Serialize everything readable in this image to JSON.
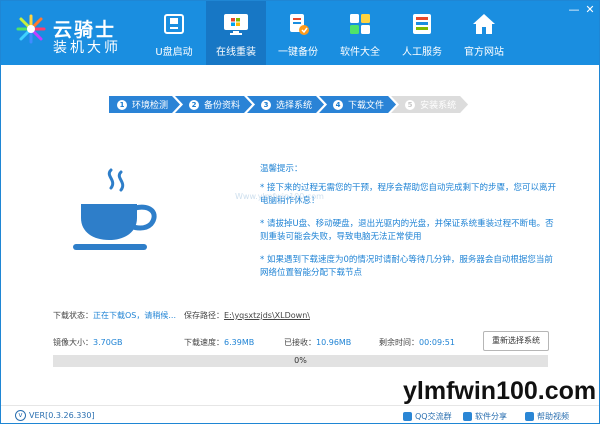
{
  "header": {
    "brand_line1": "云骑士",
    "brand_line2": "装机大师",
    "nav": [
      {
        "label": "U盘启动",
        "icon": "usb-drive-icon"
      },
      {
        "label": "在线重装",
        "icon": "windows-monitor-icon",
        "active": true
      },
      {
        "label": "一键备份",
        "icon": "backup-icon"
      },
      {
        "label": "软件大全",
        "icon": "app-grid-icon"
      },
      {
        "label": "人工服务",
        "icon": "customer-service-icon"
      },
      {
        "label": "官方网站",
        "icon": "home-icon"
      }
    ],
    "window_controls": {
      "minimize": "—",
      "close": "✕"
    }
  },
  "steps": [
    {
      "num": "1",
      "label": "环境检测",
      "state": "done"
    },
    {
      "num": "2",
      "label": "备份资料",
      "state": "done"
    },
    {
      "num": "3",
      "label": "选择系统",
      "state": "done"
    },
    {
      "num": "4",
      "label": "下载文件",
      "state": "done"
    },
    {
      "num": "5",
      "label": "安装系统",
      "state": "todo"
    }
  ],
  "tips": {
    "title": "温馨提示：",
    "items": [
      "* 接下来的过程无需您的干预，程序会帮助您自动完成剩下的步骤，您可以离开电脑稍作休息！",
      "* 请拔掉U盘、移动硬盘，退出光驱内的光盘，并保证系统重装过程不断电。否则重装可能会失败，导致电脑无法正常使用",
      "* 如果遇到下载速度为0的情况时请耐心等待几分钟，服务器会自动根据您当前网络位置智能分配下载节点"
    ],
    "watermark": "Www.ylmfwin100.com"
  },
  "download": {
    "status_label": "下载状态：",
    "status_value": "正在下载OS，请稍候...",
    "save_path_label": "保存路径：",
    "save_path_value": "E:\\yqsxtzjds\\XLDown\\",
    "image_size_label": "镜像大小：",
    "image_size_value": "3.70GB",
    "speed_label": "下载速度：",
    "speed_value": "6.39MB",
    "downloaded_label": "已接收：",
    "downloaded_value": "10.96MB",
    "remaining_label": "剩余时间：",
    "remaining_value": "00:09:51",
    "reselect_label": "重新选择系统",
    "progress_percent": 0,
    "progress_text": "0%"
  },
  "footer": {
    "version": "VER[0.3.26.330]",
    "links": [
      {
        "label": "QQ交流群",
        "icon": "qq-icon"
      },
      {
        "label": "软件分享",
        "icon": "share-icon"
      },
      {
        "label": "帮助视频",
        "icon": "help-video-icon"
      }
    ],
    "brand_watermark": "ylmfwin100.com"
  },
  "colors": {
    "primary": "#1a8ee0",
    "active_nav": "#1777c5",
    "accent_text": "#2184d5"
  }
}
